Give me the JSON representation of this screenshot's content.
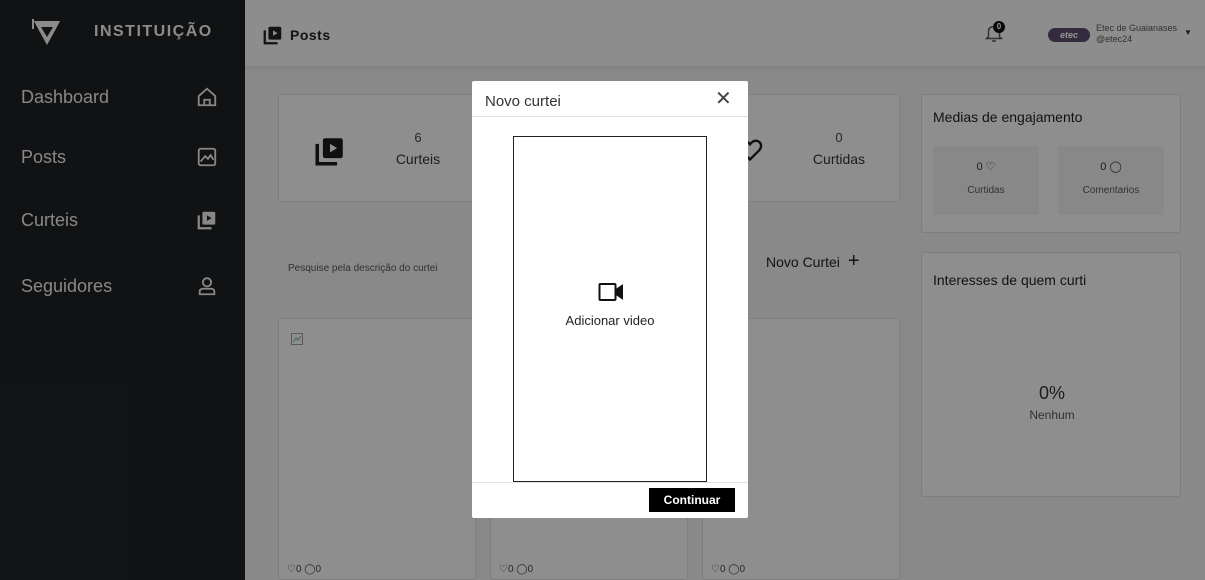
{
  "app": {
    "brand": "INSTITUIÇÃO",
    "page_title": "Posts"
  },
  "sidebar": {
    "items": [
      {
        "label": "Dashboard",
        "icon": "home-icon"
      },
      {
        "label": "Posts",
        "icon": "image-icon"
      },
      {
        "label": "Curteis",
        "icon": "video-stack-icon"
      },
      {
        "label": "Seguidores",
        "icon": "user-icon"
      }
    ]
  },
  "topbar": {
    "notification_count": "0",
    "profile_logo_text": "etec",
    "profile_name": "Etec de Guaianases",
    "profile_handle": "@etec24"
  },
  "stats": {
    "curteis_count": "6",
    "curteis_label": "Curteis",
    "curtidas_count": "0",
    "curtidas_label": "Curtidas"
  },
  "search": {
    "placeholder": "Pesquise pela descrição do curtei"
  },
  "new_curtei_label": "Novo Curtei",
  "posts": [
    {
      "likes": "0",
      "comments": "0"
    },
    {
      "likes": "0",
      "comments": "0"
    },
    {
      "likes": "0",
      "comments": "0"
    }
  ],
  "engagement": {
    "title": "Medias de engajamento",
    "likes_value": "0",
    "likes_label": "Curtidas",
    "comments_value": "0",
    "comments_label": "Comentarios"
  },
  "interests": {
    "title": "Interesses de quem curti",
    "percent": "0%",
    "label": "Nenhum"
  },
  "modal": {
    "title": "Novo curtei",
    "close_symbol": "✕",
    "add_video_label": "Adicionar video",
    "continue_label": "Continuar"
  }
}
